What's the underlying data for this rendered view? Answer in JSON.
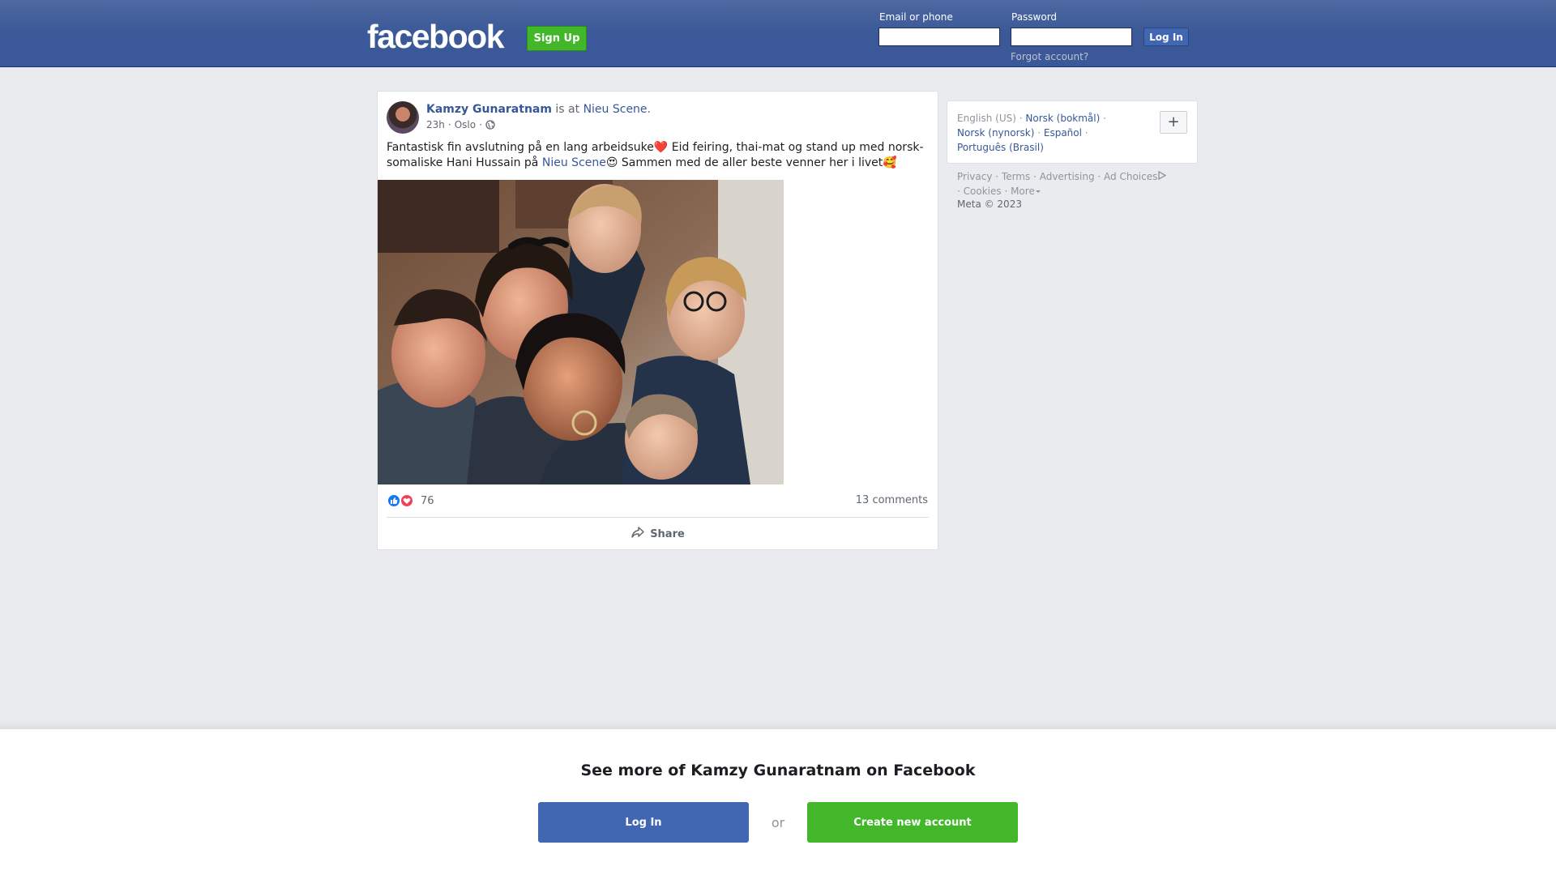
{
  "header": {
    "logo": "facebook",
    "signup_label": "Sign Up",
    "email_label": "Email or phone",
    "password_label": "Password",
    "login_label": "Log In",
    "forgot_label": "Forgot account?"
  },
  "post": {
    "author": "Kamzy Gunaratnam",
    "is_at": " is at ",
    "place": "Nieu Scene",
    "place_suffix": ".",
    "time": "23h",
    "location": "Oslo",
    "dot": "·",
    "text_before": "Fantastisk fin avslutning på en lang arbeidsuke❤️ Eid feiring, thai-mat og stand up med norsk-somaliske Hani Hussain på ",
    "text_link": "Nieu Scene",
    "text_after": "😍 Sammen med de aller beste venner her i livet🥰",
    "reaction_count": "76",
    "comments": "13 comments",
    "share_label": "Share",
    "icons": {
      "like": "like-icon",
      "love": "love-icon",
      "share": "share-icon",
      "privacy": "globe-icon"
    }
  },
  "sidebar": {
    "current_language": "English (US)",
    "languages": [
      "Norsk (bokmål)",
      "Norsk (nynorsk)",
      "Español",
      "Português (Brasil)"
    ],
    "separator": " · ",
    "plus_label": "+",
    "footer_links": [
      "Privacy",
      "Terms",
      "Advertising",
      "Ad Choices",
      "Cookies",
      "More"
    ],
    "copyright": "Meta © 2023"
  },
  "bottom": {
    "title": "See more of Kamzy Gunaratnam on Facebook",
    "login_label": "Log In",
    "or_label": "or",
    "create_label": "Create new account"
  },
  "colors": {
    "brand_blue": "#3b5998",
    "link_blue": "#365899",
    "button_blue": "#4267b2",
    "green": "#42b72a",
    "page_bg": "#e9ebee"
  }
}
